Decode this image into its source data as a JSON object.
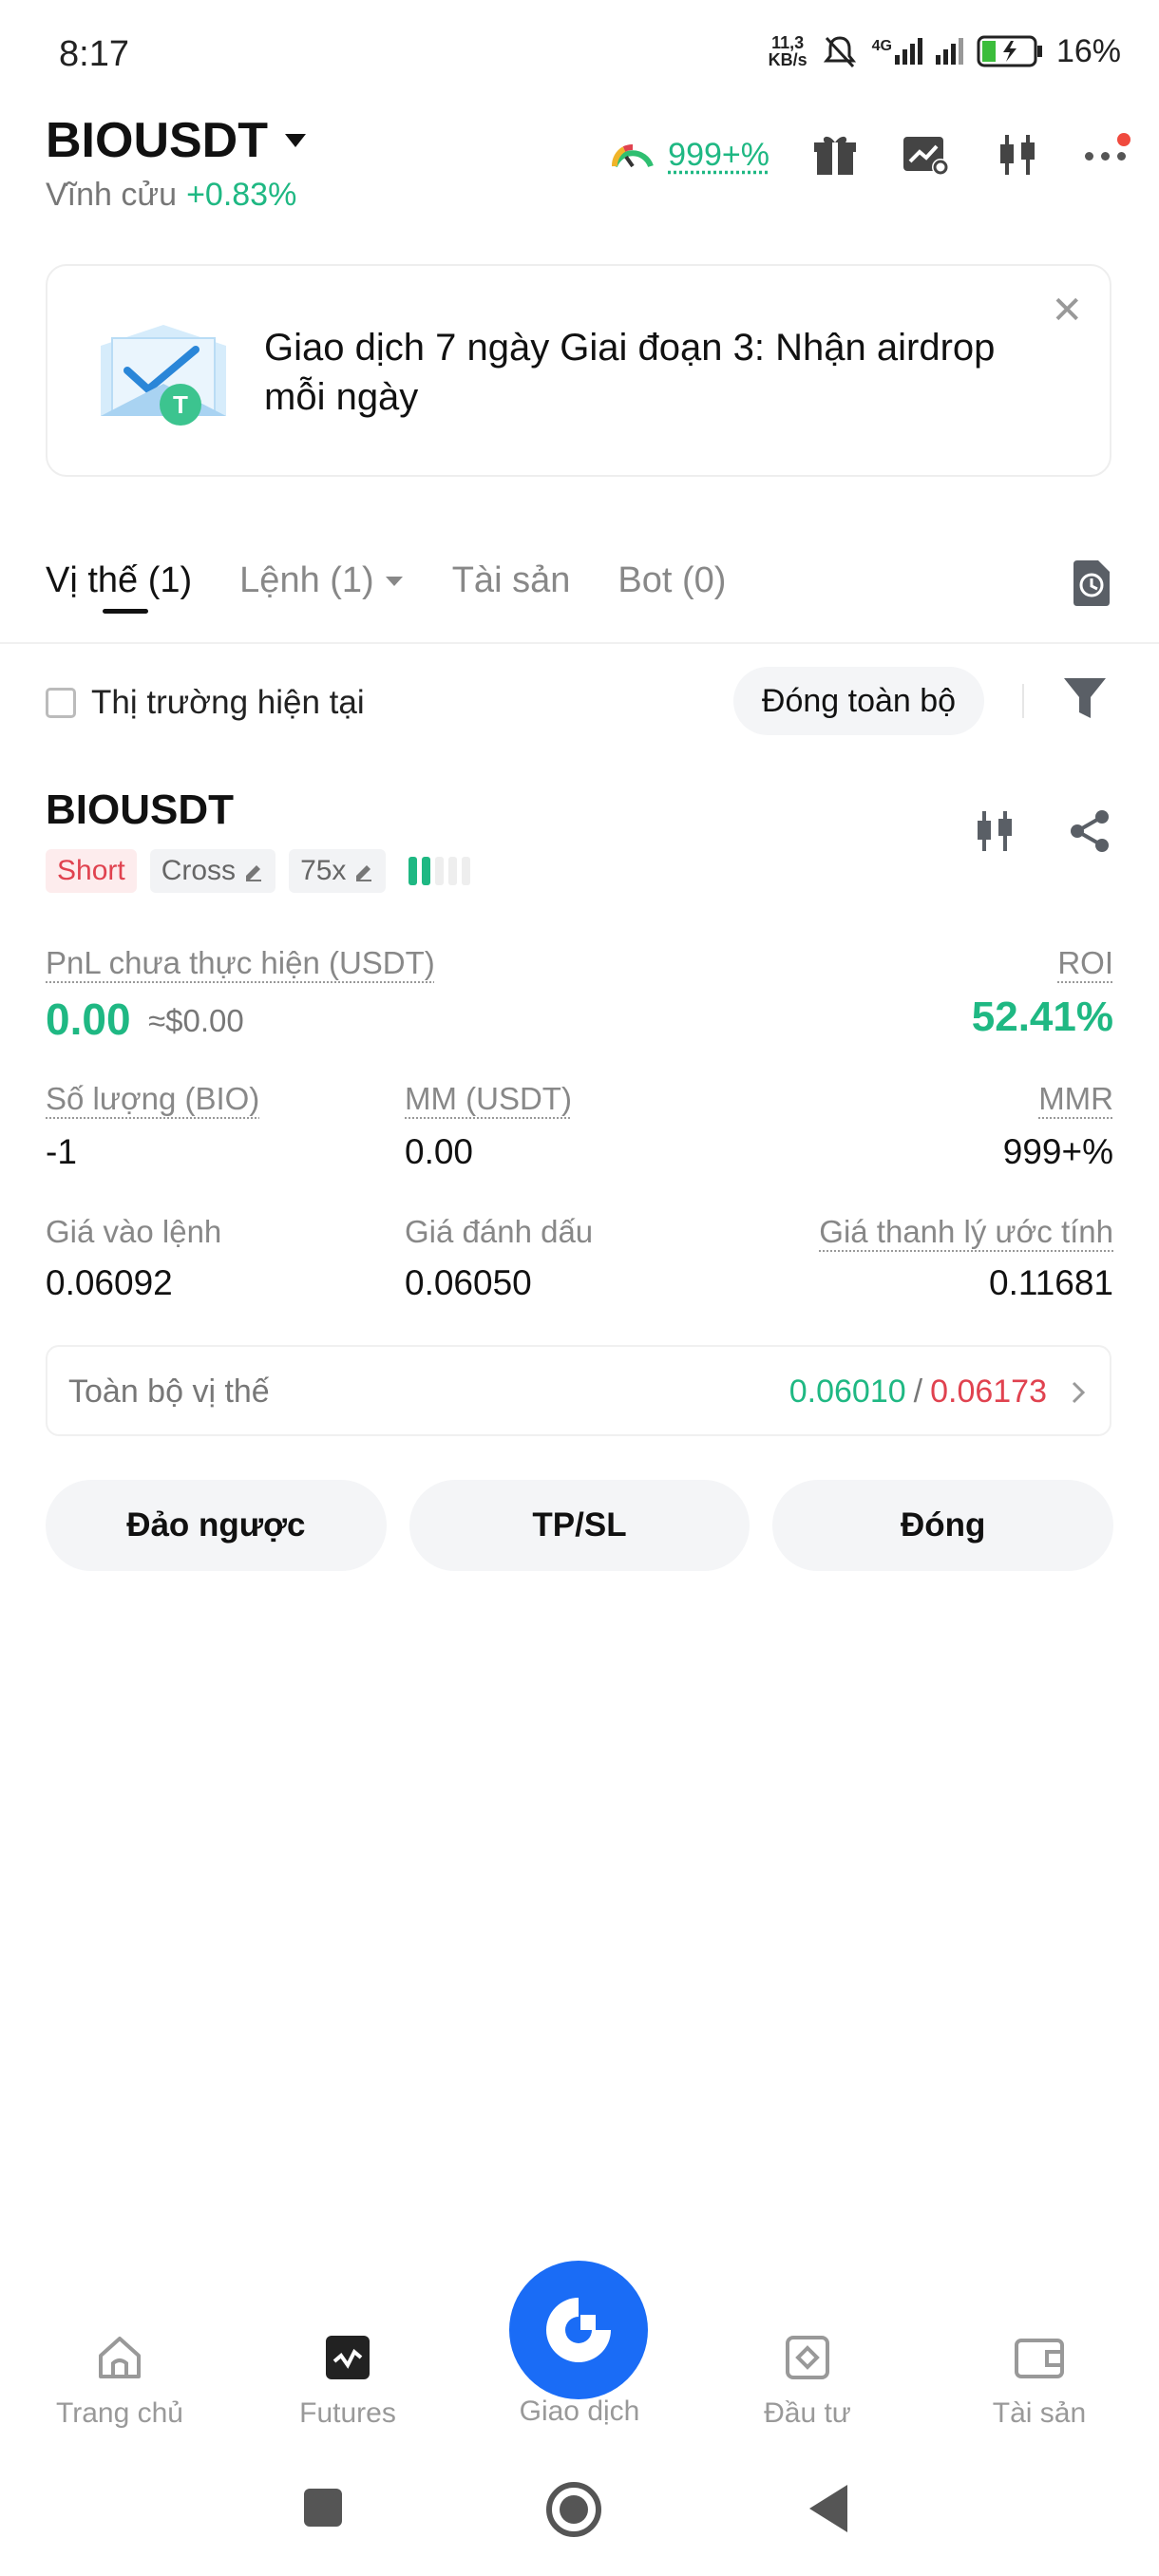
{
  "status_bar": {
    "time": "8:17",
    "net_speed_value": "11,3",
    "net_speed_unit": "KB/s",
    "network": "4G",
    "battery": "16%"
  },
  "header": {
    "pair": "BIOUSDT",
    "contract_type": "Vĩnh cửu",
    "change": "+0.83%",
    "gauge_value": "999+%",
    "icons": [
      "gauge-icon",
      "gift-icon",
      "chart-settings-icon",
      "candlestick-icon",
      "more-icon"
    ]
  },
  "banner": {
    "text": "Giao dịch 7 ngày Giai đoạn 3: Nhận airdrop mỗi ngày",
    "close": "✕"
  },
  "tabs": [
    {
      "label": "Vị thế (1)",
      "active": true
    },
    {
      "label": "Lệnh (1)",
      "dropdown": true
    },
    {
      "label": "Tài sản"
    },
    {
      "label": "Bot (0)"
    }
  ],
  "filter": {
    "checkbox_label": "Thị trường hiện tại",
    "close_all": "Đóng toàn bộ"
  },
  "position": {
    "symbol": "BIOUSDT",
    "side": "Short",
    "margin_mode": "Cross",
    "leverage": "75x",
    "leverage_level": 2,
    "pnl_label": "PnL chưa thực hiện (USDT)",
    "pnl_value": "0.00",
    "pnl_usd": "≈$0.00",
    "roi_label": "ROI",
    "roi_value": "52.41%",
    "qty_label": "Số lượng (BIO)",
    "qty_value": "-1",
    "mm_label": "MM (USDT)",
    "mm_value": "0.00",
    "mmr_label": "MMR",
    "mmr_value": "999+%",
    "entry_label": "Giá vào lệnh",
    "entry_value": "0.06092",
    "mark_label": "Giá đánh dấu",
    "mark_value": "0.06050",
    "liq_label": "Giá thanh lý ước tính",
    "liq_value": "0.11681",
    "whole_label": "Toàn bộ vị thế",
    "whole_tp": "0.06010",
    "whole_sep": "/",
    "whole_sl": "0.06173"
  },
  "actions": {
    "reverse": "Đảo ngược",
    "tpsl": "TP/SL",
    "close": "Đóng"
  },
  "bottom_nav": [
    {
      "label": "Trang chủ",
      "icon": "home-icon"
    },
    {
      "label": "Futures",
      "icon": "futures-icon"
    },
    {
      "label": "Giao dịch",
      "icon": "trade-icon"
    },
    {
      "label": "Đầu tư",
      "icon": "invest-icon"
    },
    {
      "label": "Tài sản",
      "icon": "wallet-icon"
    }
  ],
  "colors": {
    "green": "#1fb883",
    "red": "#e0424f",
    "orange": "#f28b3c",
    "accent": "#1a6cf6"
  }
}
